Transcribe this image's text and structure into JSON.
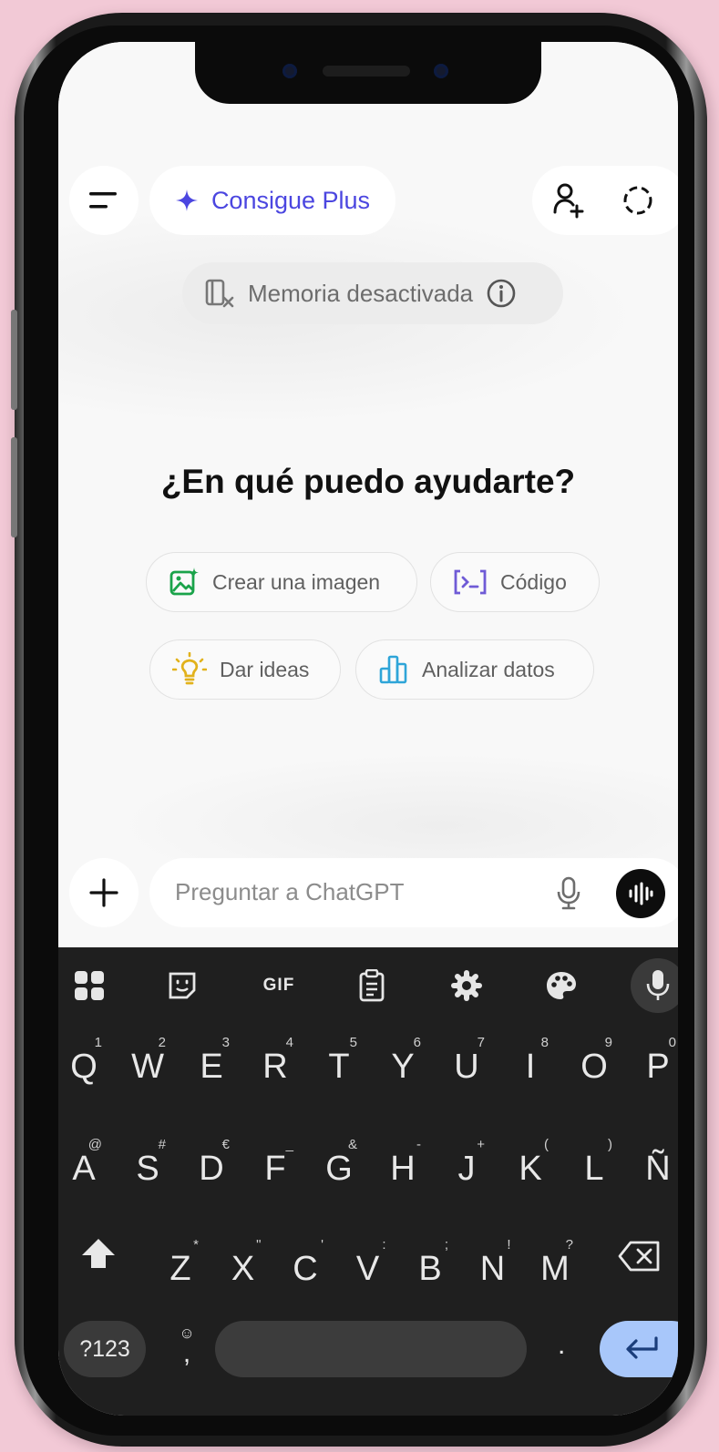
{
  "header": {
    "upgrade_label": "Consigue Plus"
  },
  "memory": {
    "label": "Memoria desactivada"
  },
  "main": {
    "heading": "¿En qué puedo ayudarte?",
    "suggestions": [
      {
        "label": "Crear una imagen",
        "icon": "image-sparkle-icon",
        "color": "#1aa34a"
      },
      {
        "label": "Código",
        "icon": "code-icon",
        "color": "#6f5bd6"
      },
      {
        "label": "Dar ideas",
        "icon": "lightbulb-icon",
        "color": "#e2b21c"
      },
      {
        "label": "Analizar datos",
        "icon": "bar-chart-icon",
        "color": "#2fa5d8"
      }
    ]
  },
  "composer": {
    "placeholder": "Preguntar a ChatGPT"
  },
  "keyboard": {
    "toolbar": {
      "gif_label": "GIF"
    },
    "row1": [
      {
        "key": "Q",
        "hint": "1"
      },
      {
        "key": "W",
        "hint": "2"
      },
      {
        "key": "E",
        "hint": "3"
      },
      {
        "key": "R",
        "hint": "4"
      },
      {
        "key": "T",
        "hint": "5"
      },
      {
        "key": "Y",
        "hint": "6"
      },
      {
        "key": "U",
        "hint": "7"
      },
      {
        "key": "I",
        "hint": "8"
      },
      {
        "key": "O",
        "hint": "9"
      },
      {
        "key": "P",
        "hint": "0"
      }
    ],
    "row2": [
      {
        "key": "A",
        "hint": "@"
      },
      {
        "key": "S",
        "hint": "#"
      },
      {
        "key": "D",
        "hint": "€"
      },
      {
        "key": "F",
        "hint": "_"
      },
      {
        "key": "G",
        "hint": "&"
      },
      {
        "key": "H",
        "hint": "-"
      },
      {
        "key": "J",
        "hint": "+"
      },
      {
        "key": "K",
        "hint": "("
      },
      {
        "key": "L",
        "hint": ")"
      },
      {
        "key": "Ñ",
        "hint": ""
      }
    ],
    "row3": [
      {
        "key": "Z",
        "hint": "*"
      },
      {
        "key": "X",
        "hint": "\""
      },
      {
        "key": "C",
        "hint": "'"
      },
      {
        "key": "V",
        "hint": ":"
      },
      {
        "key": "B",
        "hint": ";"
      },
      {
        "key": "N",
        "hint": "!"
      },
      {
        "key": "M",
        "hint": "?"
      }
    ],
    "numbers_label": "?123",
    "emoji_key": "☺",
    "comma_key": ",",
    "period_key": "."
  },
  "colors": {
    "accent": "#4b46e0",
    "keyboard_bg": "#1f1f1f",
    "enter_key": "#a8c7fa"
  }
}
